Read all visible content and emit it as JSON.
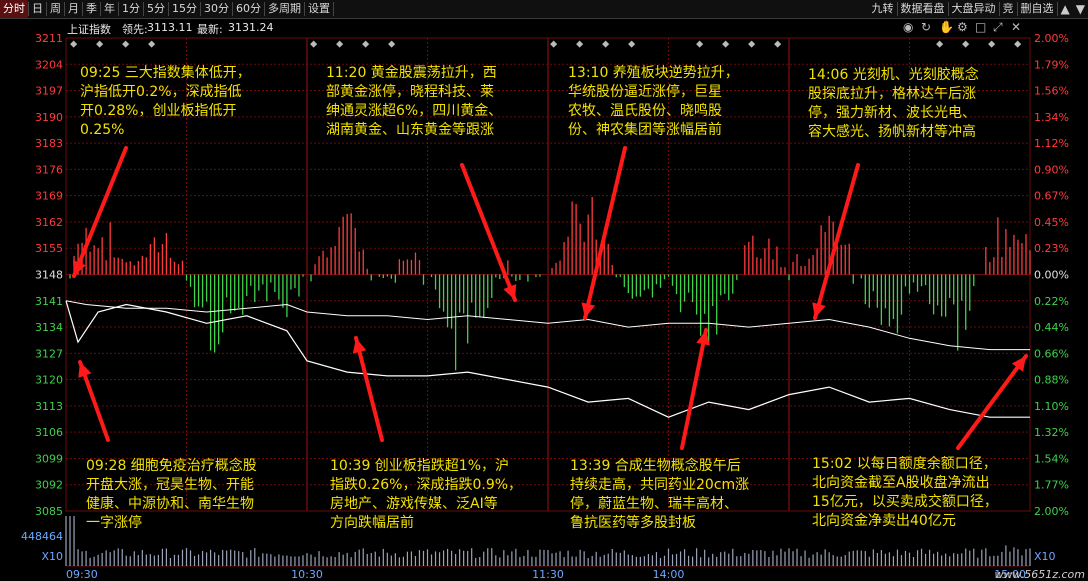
{
  "toolbar": {
    "left_tabs": [
      "分时",
      "日",
      "周",
      "月",
      "季",
      "年",
      "1分",
      "5分",
      "15分",
      "30分",
      "60分",
      "多周期",
      "设置"
    ],
    "active_tab": "分时",
    "right_tabs": [
      "九转",
      "数据看盘",
      "大盘异动",
      "竞",
      "删自选"
    ]
  },
  "info": {
    "index_name": "上证指数",
    "lead_label": "领先:",
    "lead_value": "3113.11",
    "latest_label": "最新:",
    "latest_value": "3131.24",
    "volume_label": "448464",
    "multiplier_left": "X10",
    "multiplier_right": "X10",
    "watermark": "www.5651z.com"
  },
  "icons": [
    "eye-icon",
    "refresh-icon",
    "hand-icon",
    "settings-icon",
    "square-icon",
    "zoom-icon",
    "close-icon"
  ],
  "colors": {
    "up": "#ff3b3b",
    "down": "#3fd24a",
    "price": "#ffffff",
    "avg": "#ffffff",
    "annotation": "#f2e200",
    "arrow": "#ff1a1a",
    "grid": "#6b0b0b"
  },
  "chart_data": {
    "type": "line",
    "prev_close": 3148,
    "y_price_ticks": [
      "3211",
      "3204",
      "3197",
      "3190",
      "3183",
      "3176",
      "3169",
      "3162",
      "3155",
      "3148",
      "3141",
      "3134",
      "3127",
      "3120",
      "3113",
      "3106",
      "3099",
      "3092",
      "3085"
    ],
    "y_pct_ticks": [
      "2.00%",
      "1.79%",
      "1.56%",
      "1.34%",
      "1.12%",
      "0.90%",
      "0.67%",
      "0.45%",
      "0.23%",
      "0.00%",
      "0.22%",
      "0.44%",
      "0.66%",
      "0.88%",
      "1.10%",
      "1.32%",
      "1.54%",
      "1.77%",
      "2.00%"
    ],
    "x_ticks": [
      "09:30",
      "10:30",
      "11:30",
      "14:00",
      "15:00"
    ],
    "series": [
      {
        "name": "price",
        "x": [
          0,
          3,
          8,
          15,
          25,
          35,
          45,
          55,
          60,
          70,
          80,
          90,
          100,
          110,
          120,
          130,
          140,
          150,
          160,
          170,
          180,
          190,
          200,
          210,
          220,
          230,
          240
        ],
        "values": [
          3141,
          3130,
          3138,
          3140,
          3138,
          3135,
          3137,
          3133,
          3125,
          3122,
          3121,
          3121,
          3122,
          3120,
          3118,
          3114,
          3115,
          3110,
          3114,
          3112,
          3116,
          3118,
          3114,
          3115,
          3112,
          3110,
          3110
        ]
      },
      {
        "name": "avg",
        "x": [
          0,
          5,
          15,
          25,
          35,
          45,
          55,
          60,
          70,
          80,
          90,
          100,
          110,
          120,
          130,
          140,
          150,
          160,
          170,
          180,
          190,
          200,
          210,
          220,
          230,
          240
        ],
        "values": [
          3141,
          3140,
          3139,
          3139,
          3138,
          3139,
          3140,
          3138,
          3137,
          3137,
          3136,
          3137,
          3136,
          3135,
          3136,
          3134,
          3135,
          3135,
          3134,
          3135,
          3136,
          3134,
          3131,
          3129,
          3128,
          3128
        ]
      }
    ]
  },
  "annotations": [
    {
      "time": "09:25",
      "text": "09:25 三大指数集体低开，\n沪指低开0.2%，深成指低\n开0.28%，创业板指低开\n0.25%"
    },
    {
      "time": "11:20",
      "text": "11:20 黄金股震荡拉升，西\n部黄金涨停，晓程科技、莱\n绅通灵涨超6%，四川黄金、\n湖南黄金、山东黄金等跟涨"
    },
    {
      "time": "13:10",
      "text": "13:10 养殖板块逆势拉升，\n华统股份逼近涨停，巨星\n农牧、温氏股份、晓鸣股\n份、神农集团等涨幅居前"
    },
    {
      "time": "14:06",
      "text": "14:06 光刻机、光刻胶概念\n股探底拉升，格林达午后涨\n停，强力新材、波长光电、\n容大感光、扬帆新材等冲高"
    },
    {
      "time": "09:28",
      "text": "09:28 细胞免疫治疗概念股\n开盘大涨，冠昊生物、开能\n健康、中源协和、南华生物\n一字涨停"
    },
    {
      "time": "10:39",
      "text": "10:39 创业板指跌超1%，沪\n指跌0.26%，深成指跌0.9%，\n房地产、游戏传媒、泛AI等\n方向跌幅居前"
    },
    {
      "time": "13:39",
      "text": "13:39 合成生物概念股午后\n持续走高，共同药业20cm涨\n停，蔚蓝生物、瑞丰高材、\n鲁抗医药等多股封板"
    },
    {
      "time": "15:02",
      "text": "15:02 以每日额度余额口径，\n北向资金截至A股收盘净流出\n15亿元，以买卖成交额口径，\n北向资金净卖出40亿元"
    }
  ]
}
